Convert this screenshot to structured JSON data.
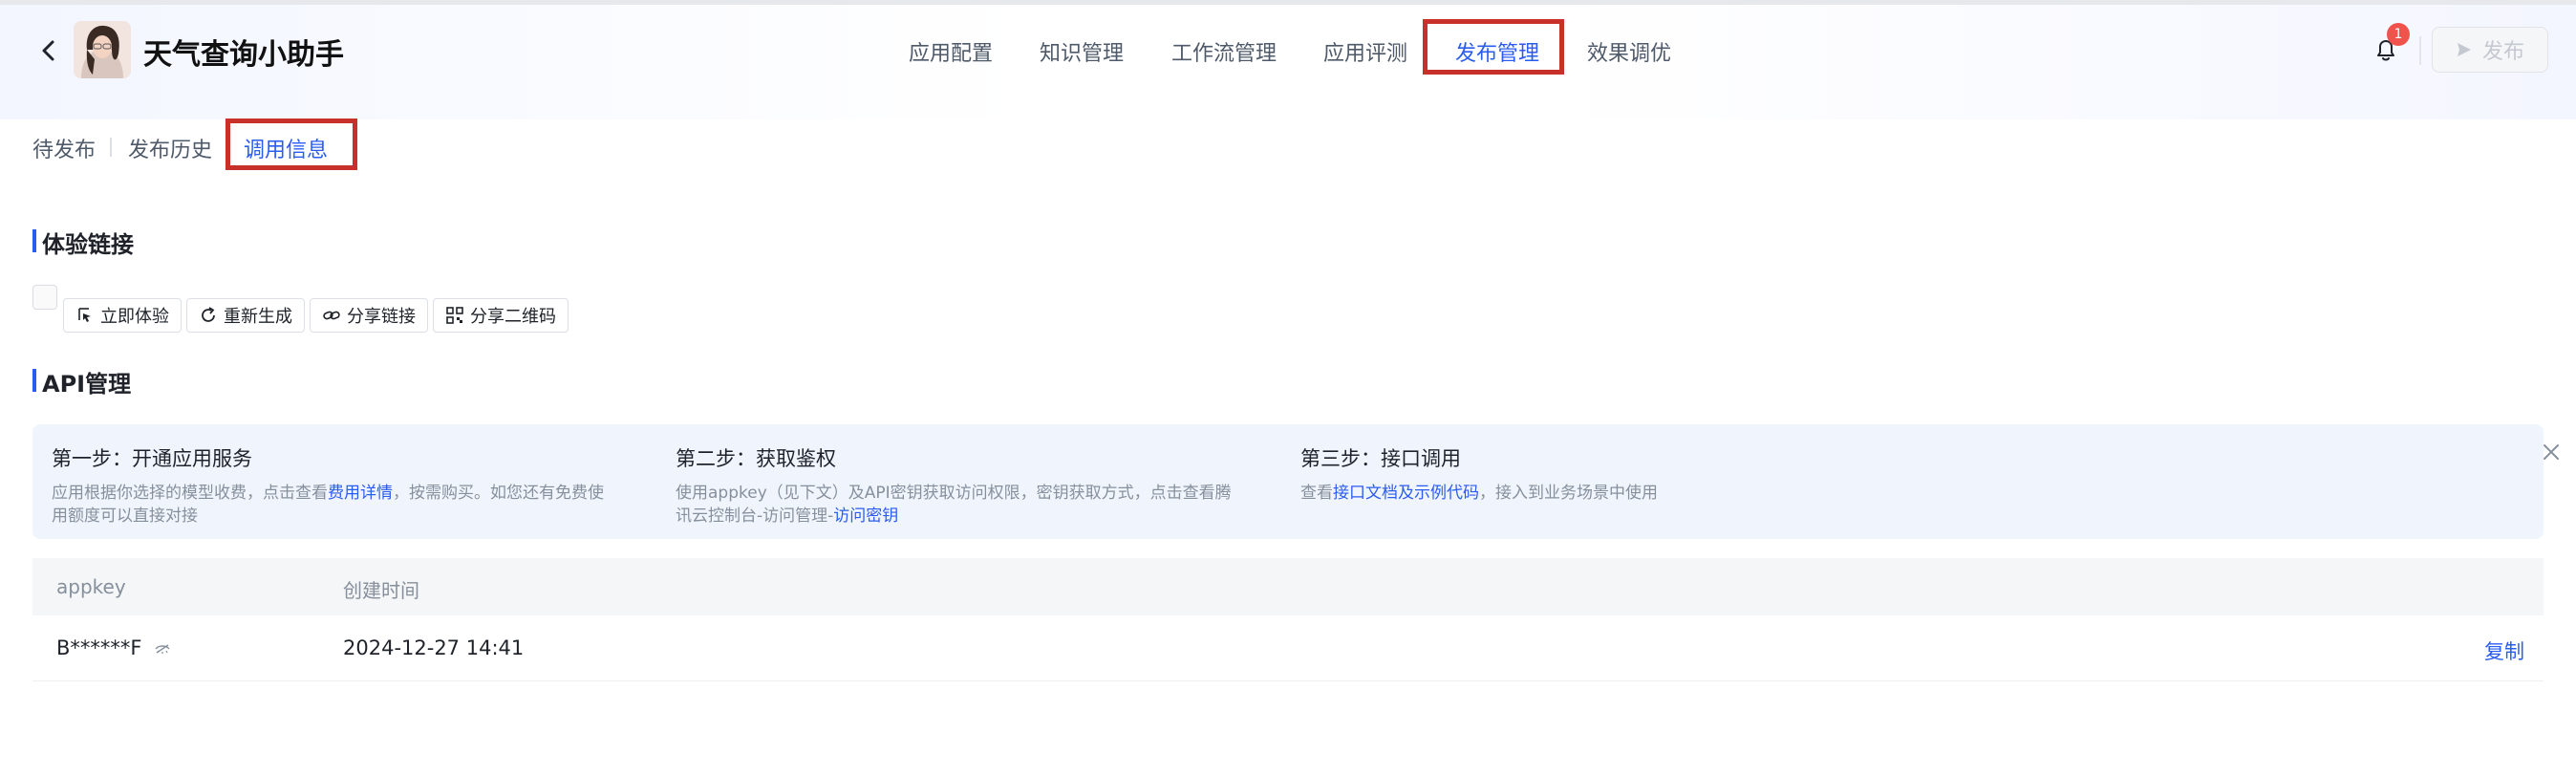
{
  "header": {
    "app_title": "天气查询小助手",
    "publish_label": "发布",
    "notification_count": "1"
  },
  "nav": {
    "tabs": [
      "应用配置",
      "知识管理",
      "工作流管理",
      "应用评测",
      "发布管理",
      "效果调优"
    ],
    "active": "发布管理"
  },
  "subtabs": {
    "items": [
      "待发布",
      "发布历史",
      "调用信息"
    ],
    "active": "调用信息"
  },
  "experience": {
    "title": "体验链接",
    "buttons": [
      "立即体验",
      "重新生成",
      "分享链接",
      "分享二维码"
    ]
  },
  "api": {
    "title": "API管理",
    "steps": [
      {
        "title": "第一步：开通应用服务",
        "desc_a": "应用根据你选择的模型收费，点击查看",
        "link": "费用详情",
        "desc_b": "，按需购买。如您还有免费使",
        "desc_c": "用额度可以直接对接"
      },
      {
        "title": "第二步：获取鉴权",
        "desc_a": "使用appkey（见下文）及API密钥获取访问权限，密钥获取方式，点击查看腾",
        "desc_b": "讯云控制台-访问管理-",
        "link": "访问密钥"
      },
      {
        "title": "第三步：接口调用",
        "desc_a": "查看",
        "link": "接口文档及示例代码",
        "desc_b": "，接入到业务场景中使用"
      }
    ],
    "table": {
      "columns": [
        "appkey",
        "创建时间"
      ],
      "rows": [
        {
          "appkey": "B******F",
          "created": "2024-12-27 14:41",
          "action": "复制"
        }
      ]
    }
  },
  "colors": {
    "accent": "#2b5cf0",
    "highlight_box": "#c8302a",
    "badge": "#f0524c"
  }
}
